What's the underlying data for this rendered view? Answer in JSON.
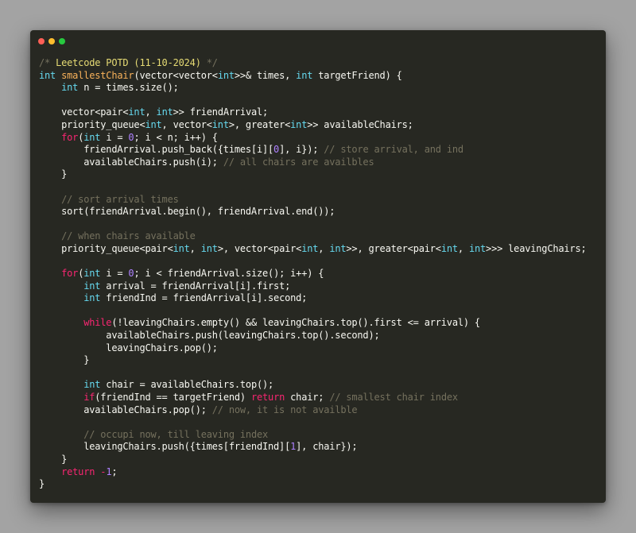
{
  "window": {
    "buttons": [
      {
        "name": "close",
        "color": "#ff5f56"
      },
      {
        "name": "minimize",
        "color": "#ffbd2e"
      },
      {
        "name": "zoom",
        "color": "#27c93f"
      }
    ]
  },
  "colors": {
    "background": "#a3a3a3",
    "editor": "#272822",
    "comment": "#75715e",
    "keyword": "#f92672",
    "type": "#66d9ef",
    "function": "#f9b25a",
    "number": "#ae81ff",
    "plain": "#f8f8f2"
  },
  "code": {
    "lines": [
      [
        [
          "comment",
          "/* "
        ],
        [
          "title",
          "Leetcode POTD (11-10-2024)"
        ],
        [
          "comment",
          " */"
        ]
      ],
      [
        [
          "type",
          "int"
        ],
        [
          "plain",
          " "
        ],
        [
          "function",
          "smallestChair"
        ],
        [
          "plain",
          "(vector<vector<"
        ],
        [
          "type",
          "int"
        ],
        [
          "plain",
          ">>& times, "
        ],
        [
          "type",
          "int"
        ],
        [
          "plain",
          " targetFriend) {"
        ]
      ],
      [
        [
          "plain",
          "    "
        ],
        [
          "type",
          "int"
        ],
        [
          "plain",
          " n = times.size();"
        ]
      ],
      [],
      [
        [
          "plain",
          "    vector<pair<"
        ],
        [
          "type",
          "int"
        ],
        [
          "plain",
          ", "
        ],
        [
          "type",
          "int"
        ],
        [
          "plain",
          ">> friendArrival;"
        ]
      ],
      [
        [
          "plain",
          "    priority_queue<"
        ],
        [
          "type",
          "int"
        ],
        [
          "plain",
          ", vector<"
        ],
        [
          "type",
          "int"
        ],
        [
          "plain",
          ">, greater<"
        ],
        [
          "type",
          "int"
        ],
        [
          "plain",
          ">> availableChairs;"
        ]
      ],
      [
        [
          "plain",
          "    "
        ],
        [
          "keyword",
          "for"
        ],
        [
          "plain",
          "("
        ],
        [
          "type",
          "int"
        ],
        [
          "plain",
          " i = "
        ],
        [
          "number",
          "0"
        ],
        [
          "plain",
          "; i < n; i++) {"
        ]
      ],
      [
        [
          "plain",
          "        friendArrival.push_back({times[i]["
        ],
        [
          "number",
          "0"
        ],
        [
          "plain",
          "], i}); "
        ],
        [
          "comment",
          "// store arrival, and ind"
        ]
      ],
      [
        [
          "plain",
          "        availableChairs.push(i); "
        ],
        [
          "comment",
          "// all chairs are availbles"
        ]
      ],
      [
        [
          "plain",
          "    }"
        ]
      ],
      [],
      [
        [
          "plain",
          "    "
        ],
        [
          "comment",
          "// sort arrival times"
        ]
      ],
      [
        [
          "plain",
          "    sort(friendArrival.begin(), friendArrival.end());"
        ]
      ],
      [],
      [
        [
          "plain",
          "    "
        ],
        [
          "comment",
          "// when chairs available"
        ]
      ],
      [
        [
          "plain",
          "    priority_queue<pair<"
        ],
        [
          "type",
          "int"
        ],
        [
          "plain",
          ", "
        ],
        [
          "type",
          "int"
        ],
        [
          "plain",
          ">, vector<pair<"
        ],
        [
          "type",
          "int"
        ],
        [
          "plain",
          ", "
        ],
        [
          "type",
          "int"
        ],
        [
          "plain",
          ">>, greater<pair<"
        ],
        [
          "type",
          "int"
        ],
        [
          "plain",
          ", "
        ],
        [
          "type",
          "int"
        ],
        [
          "plain",
          ">>> leavingChairs;"
        ]
      ],
      [],
      [
        [
          "plain",
          "    "
        ],
        [
          "keyword",
          "for"
        ],
        [
          "plain",
          "("
        ],
        [
          "type",
          "int"
        ],
        [
          "plain",
          " i = "
        ],
        [
          "number",
          "0"
        ],
        [
          "plain",
          "; i < friendArrival.size(); i++) {"
        ]
      ],
      [
        [
          "plain",
          "        "
        ],
        [
          "type",
          "int"
        ],
        [
          "plain",
          " arrival = friendArrival[i].first;"
        ]
      ],
      [
        [
          "plain",
          "        "
        ],
        [
          "type",
          "int"
        ],
        [
          "plain",
          " friendInd = friendArrival[i].second;"
        ]
      ],
      [],
      [
        [
          "plain",
          "        "
        ],
        [
          "keyword",
          "while"
        ],
        [
          "plain",
          "(!leavingChairs.empty() && leavingChairs.top().first <= arrival) {"
        ]
      ],
      [
        [
          "plain",
          "            availableChairs.push(leavingChairs.top().second);"
        ]
      ],
      [
        [
          "plain",
          "            leavingChairs.pop();"
        ]
      ],
      [
        [
          "plain",
          "        }"
        ]
      ],
      [],
      [
        [
          "plain",
          "        "
        ],
        [
          "type",
          "int"
        ],
        [
          "plain",
          " chair = availableChairs.top();"
        ]
      ],
      [
        [
          "plain",
          "        "
        ],
        [
          "keyword",
          "if"
        ],
        [
          "plain",
          "(friendInd == targetFriend) "
        ],
        [
          "keyword",
          "return"
        ],
        [
          "plain",
          " chair; "
        ],
        [
          "comment",
          "// smallest chair index"
        ]
      ],
      [
        [
          "plain",
          "        availableChairs.pop(); "
        ],
        [
          "comment",
          "// now, it is not availble"
        ]
      ],
      [],
      [
        [
          "plain",
          "        "
        ],
        [
          "comment",
          "// occupi now, till leaving index"
        ]
      ],
      [
        [
          "plain",
          "        leavingChairs.push({times[friendInd]["
        ],
        [
          "number",
          "1"
        ],
        [
          "plain",
          "], chair});"
        ]
      ],
      [
        [
          "plain",
          "    }"
        ]
      ],
      [
        [
          "plain",
          "    "
        ],
        [
          "keyword",
          "return"
        ],
        [
          "plain",
          " "
        ],
        [
          "keyword",
          "-"
        ],
        [
          "number",
          "1"
        ],
        [
          "plain",
          ";"
        ]
      ],
      [
        [
          "plain",
          "}"
        ]
      ]
    ]
  }
}
